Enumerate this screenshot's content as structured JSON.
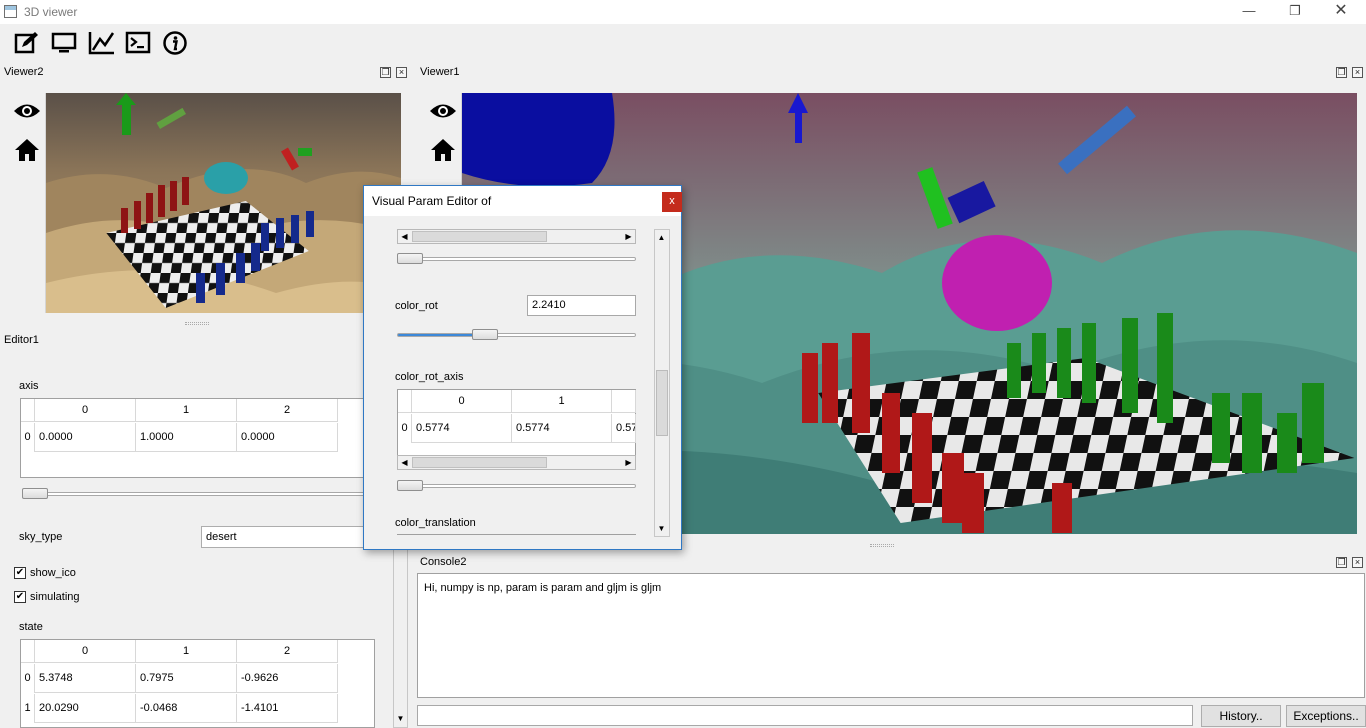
{
  "window": {
    "title": "3D viewer"
  },
  "toolbar": {
    "items": [
      "edit-icon",
      "monitor-icon",
      "chart-icon",
      "terminal-icon",
      "info-icon"
    ]
  },
  "viewer2": {
    "title": "Viewer2"
  },
  "viewer1": {
    "title": "Viewer1"
  },
  "editor": {
    "title": "Editor1",
    "axis": {
      "label": "axis",
      "columns": [
        "0",
        "1",
        "2"
      ],
      "rows": [
        {
          "header": "0",
          "cells": [
            "0.0000",
            "1.0000",
            "0.0000"
          ]
        }
      ]
    },
    "sky_type": {
      "label": "sky_type",
      "value": "desert"
    },
    "show_ico": {
      "label": "show_ico",
      "checked": true
    },
    "simulating": {
      "label": "simulating",
      "checked": true
    },
    "state": {
      "label": "state",
      "columns": [
        "0",
        "1",
        "2"
      ],
      "rows": [
        {
          "header": "0",
          "cells": [
            "5.3748",
            "0.7975",
            "-0.9626"
          ]
        },
        {
          "header": "1",
          "cells": [
            "20.0290",
            "-0.0468",
            "-1.4101"
          ]
        }
      ]
    }
  },
  "popup": {
    "title": "Visual Param Editor of",
    "close_label": "x",
    "color_rot": {
      "label": "color_rot",
      "value": "2.2410"
    },
    "color_rot_axis": {
      "label": "color_rot_axis",
      "columns": [
        "0",
        "1"
      ],
      "rows": [
        {
          "header": "0",
          "cells": [
            "0.5774",
            "0.5774",
            "0.57"
          ]
        }
      ]
    },
    "color_translation": {
      "label": "color_translation"
    }
  },
  "console": {
    "title": "Console2",
    "output": "Hi, numpy is np, param is param and gljm is gljm",
    "input_value": "",
    "history_label": "History..",
    "exceptions_label": "Exceptions.."
  },
  "colors": {
    "accent": "#2f78c4",
    "close": "#c42b1c"
  }
}
